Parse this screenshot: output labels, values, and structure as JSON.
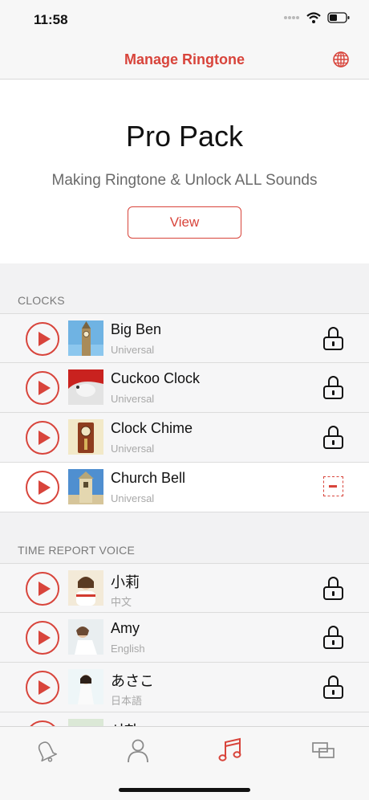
{
  "status": {
    "time": "11:58"
  },
  "header": {
    "title": "Manage Ringtone"
  },
  "promo": {
    "title": "Pro Pack",
    "subtitle": "Making Ringtone & Unlock ALL Sounds",
    "button_label": "View"
  },
  "sections": {
    "clocks": {
      "header": "CLOCKS",
      "items": [
        {
          "name": "Big Ben",
          "sub": "Universal",
          "state": "locked"
        },
        {
          "name": "Cuckoo Clock",
          "sub": "Universal",
          "state": "locked"
        },
        {
          "name": "Clock Chime",
          "sub": "Universal",
          "state": "locked"
        },
        {
          "name": "Church Bell",
          "sub": "Universal",
          "state": "active"
        }
      ]
    },
    "voice": {
      "header": "TIME REPORT VOICE",
      "items": [
        {
          "name": "小莉",
          "sub": "中文",
          "state": "locked"
        },
        {
          "name": "Amy",
          "sub": "English",
          "state": "locked"
        },
        {
          "name": "あさこ",
          "sub": "日本語",
          "state": "locked"
        },
        {
          "name": "서희",
          "sub": "",
          "state": "locked"
        }
      ]
    }
  },
  "tabs": [
    {
      "icon": "bell-icon",
      "selected": false
    },
    {
      "icon": "person-icon",
      "selected": false
    },
    {
      "icon": "music-note-icon",
      "selected": true
    },
    {
      "icon": "switch-icon",
      "selected": false
    }
  ],
  "colors": {
    "accent": "#d8443b",
    "text": "#111111",
    "subtext": "#a8a8a8",
    "background": "#f2f2f3"
  }
}
